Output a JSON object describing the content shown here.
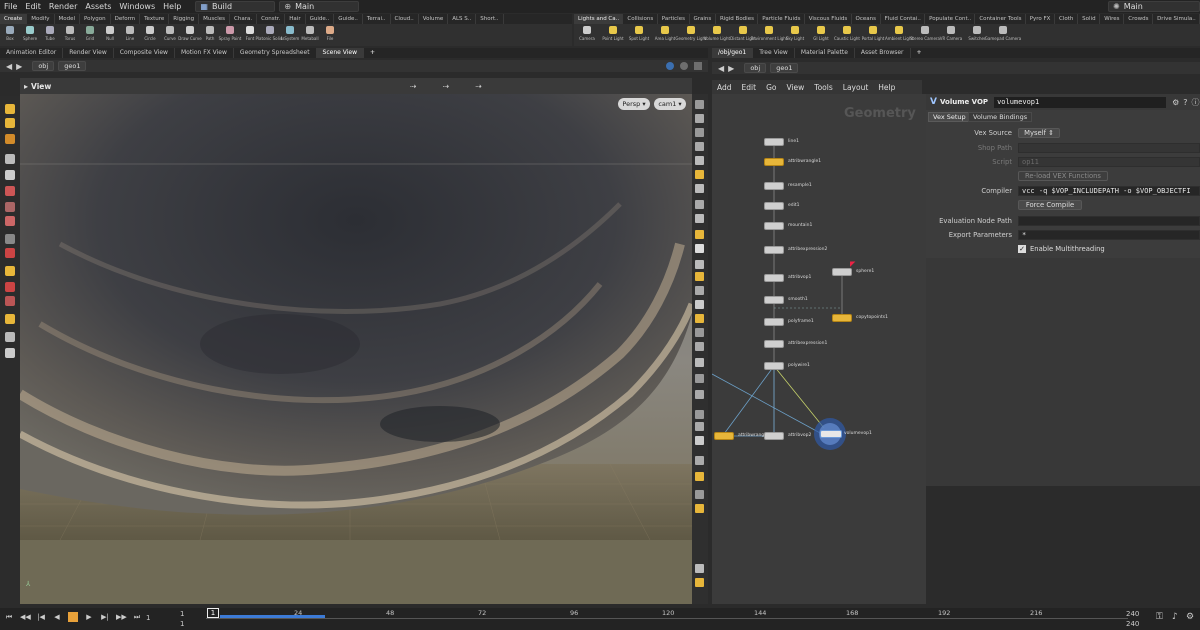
{
  "menubar": {
    "items": [
      "File",
      "Edit",
      "Render",
      "Assets",
      "Windows",
      "Help"
    ],
    "desktop": "Build",
    "main_desk": "Main",
    "right_desk": "Main"
  },
  "shelf_left_tabs": [
    "Create",
    "Modify",
    "Model",
    "Polygon",
    "Deform",
    "Texture",
    "Rigging",
    "Muscles",
    "Chara.",
    "Constr.",
    "Hair",
    "Guide..",
    "Guide..",
    "Terrai..",
    "Cloud..",
    "Volume",
    "ALS S..",
    "Short.."
  ],
  "shelf_right_tabs": [
    "Lights and Ca..",
    "Collisions",
    "Particles",
    "Grains",
    "Rigid Bodies",
    "Particle Fluids",
    "Viscous Fluids",
    "Oceans",
    "Fluid Contai..",
    "Populate Cont..",
    "Container Tools",
    "Pyro FX",
    "Cloth",
    "Solid",
    "Wires",
    "Crowds",
    "Drive Simula.."
  ],
  "shelf_left_tools": [
    "Box",
    "Sphere",
    "Tube",
    "Torus",
    "Grid",
    "Null",
    "Line",
    "Circle",
    "Curve",
    "Draw Curve",
    "Path",
    "Spray Paint",
    "Font",
    "Platonic Solids",
    "L-System",
    "Metaball",
    "File"
  ],
  "shelf_right_tools": [
    "Camera",
    "Point Light",
    "Spot Light",
    "Area Light",
    "Geometry Light",
    "Volume Light",
    "Distant Light",
    "Environment Light",
    "Sky Light",
    "GI Light",
    "Caustic Light",
    "Portal Light",
    "Ambient Light",
    "Stereo Camera",
    "VR Camera",
    "Switcher",
    "Gamepad Camera"
  ],
  "left_pane_tabs": [
    "Animation Editor",
    "Render View",
    "Composite View",
    "Motion FX View",
    "Geometry Spreadsheet",
    "Scene View"
  ],
  "right_pane_tabs": [
    "/obj/geo1",
    "Tree View",
    "Material Palette",
    "Asset Browser"
  ],
  "left_path": [
    "obj",
    "geo1"
  ],
  "right_path": [
    "obj",
    "geo1"
  ],
  "viewport": {
    "label": "View",
    "persp": "Persp",
    "cam": "cam1"
  },
  "network_menu": [
    "Add",
    "Edit",
    "Go",
    "View",
    "Tools",
    "Layout",
    "Help"
  ],
  "network_watermark": "Geometry",
  "nodes": [
    "line1",
    "attribwrangle1",
    "resample1",
    "edit1",
    "mountain1",
    "attribexpression2",
    "attribvop1",
    "smooth1",
    "polyframe1",
    "attribexpression1",
    "polywire1",
    "attribwrangle1",
    "attribvop2",
    "volumevop1",
    "sphere1",
    "copytopoints1"
  ],
  "params": {
    "type": "Volume VOP",
    "name": "volumevop1",
    "tabs": [
      "Vex Setup",
      "Volume Bindings"
    ],
    "vex_source_label": "Vex Source",
    "vex_source_value": "Myself",
    "shop_path_label": "Shop Path",
    "script_label": "Script",
    "script_value": "op11",
    "reload_label": "Re-load VEX Functions",
    "compiler_label": "Compiler",
    "compiler_value": "vcc -q $VOP_INCLUDEPATH -o $VOP_OBJECTFI",
    "force_compile_label": "Force Compile",
    "eval_path_label": "Evaluation Node Path",
    "export_params_label": "Export Parameters",
    "export_params_value": "*",
    "multithread_label": "Enable Multithreading"
  },
  "timeline": {
    "start": "1",
    "start2": "1",
    "current": "1",
    "ticks": [
      "24",
      "48",
      "72",
      "96",
      "120",
      "144",
      "168",
      "192",
      "216"
    ],
    "end": "240",
    "end2": "240"
  }
}
